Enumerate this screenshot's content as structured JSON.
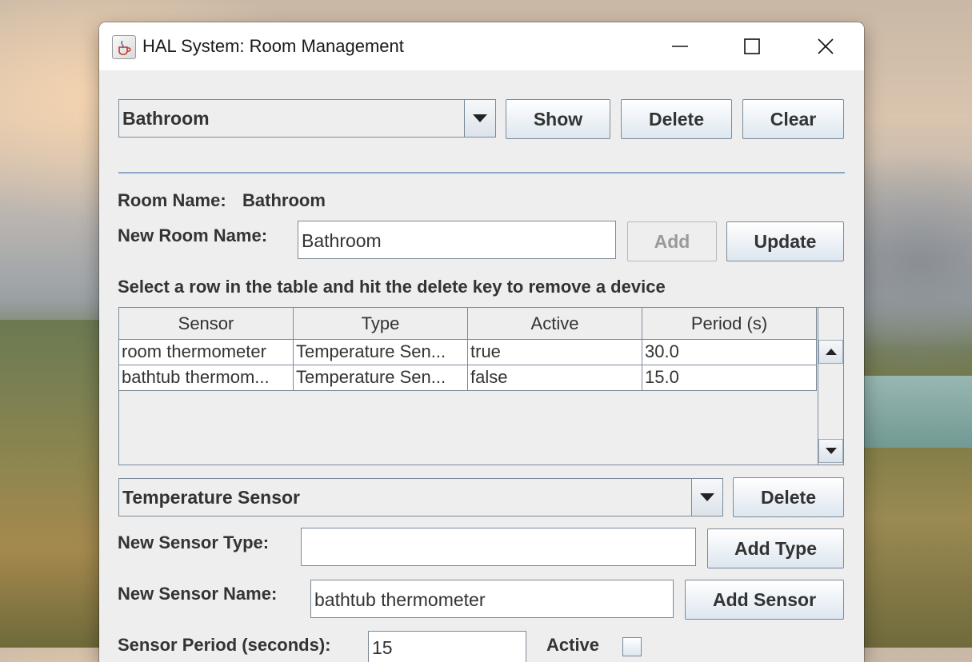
{
  "window": {
    "title": "HAL System: Room Management"
  },
  "room_selector": {
    "selected": "Bathroom",
    "show_label": "Show",
    "delete_label": "Delete",
    "clear_label": "Clear"
  },
  "room_info": {
    "room_name_label": "Room Name:",
    "room_name_value": "Bathroom",
    "new_room_name_label": "New Room Name:",
    "new_room_name_value": "Bathroom",
    "add_label": "Add",
    "update_label": "Update"
  },
  "instructions": "Select a row in the table and hit the delete key to remove a device",
  "device_table": {
    "columns": [
      "Sensor",
      "Type",
      "Active",
      "Period (s)"
    ],
    "rows": [
      [
        "room thermometer",
        "Temperature Sen...",
        "true",
        "30.0"
      ],
      [
        "bathtub thermom...",
        "Temperature Sen...",
        "false",
        "15.0"
      ]
    ]
  },
  "sensor_type_selector": {
    "selected": "Temperature Sensor",
    "delete_label": "Delete"
  },
  "sensor_form": {
    "new_sensor_type_label": "New Sensor Type:",
    "new_sensor_type_value": "",
    "add_type_label": "Add Type",
    "new_sensor_name_label": "New Sensor Name:",
    "new_sensor_name_value": "bathtub thermometer",
    "add_sensor_label": "Add Sensor",
    "sensor_period_label": "Sensor Period (seconds):",
    "sensor_period_value": "15",
    "active_label": "Active",
    "active_checked": false
  },
  "icons": {
    "app": "java-coffee-cup-icon",
    "minimize": "minimize-icon",
    "maximize": "maximize-icon",
    "close": "close-icon",
    "dropdown": "chevron-down-icon",
    "scroll_up": "arrow-up-icon",
    "scroll_down": "arrow-down-icon"
  }
}
